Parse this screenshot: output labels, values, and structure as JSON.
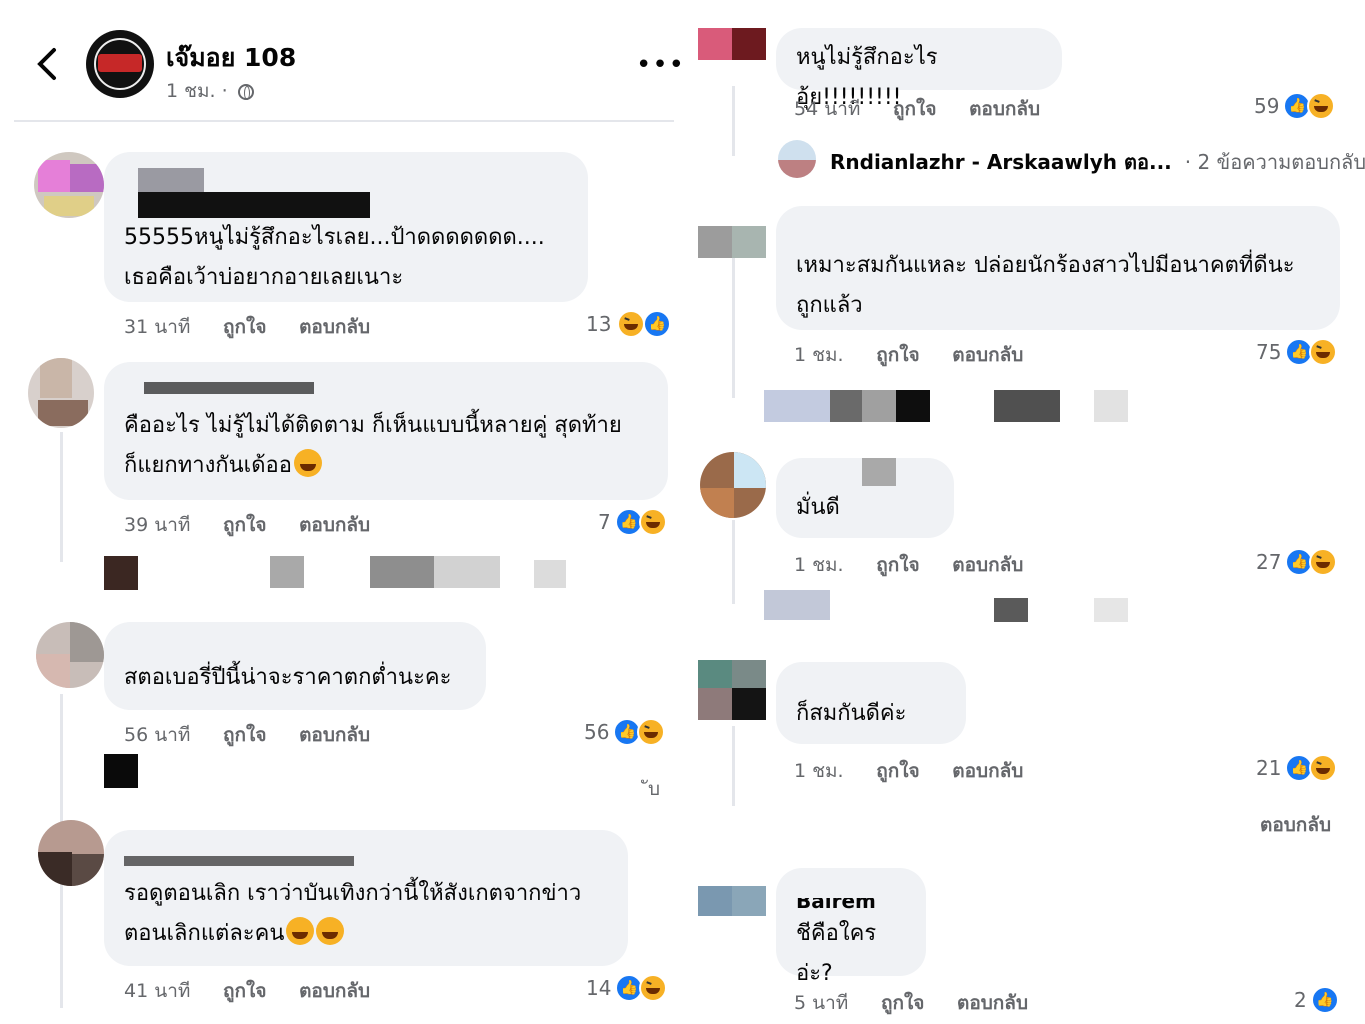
{
  "header": {
    "page_name": "เจ๊มอย 108",
    "time": "1 ชม. ·",
    "more": "•••"
  },
  "comments_left": [
    {
      "text": "55555หนูไม่รู้สึกอะไรเลย...ป้าดดดดดดด....\nเธอคือเว้าบ่อยากอายเลยเนาะ",
      "time": "31 นาที",
      "like": "ถูกใจ",
      "reply": "ตอบกลับ",
      "count": "13"
    },
    {
      "text": "คืออะไร ไม่รู้ไม่ได้ติดตาม ก็เห็นแบบนี้หลายคู่ สุดท้าย\nก็แยกทางกันเด้ออ",
      "time": "39 นาที",
      "like": "ถูกใจ",
      "reply": "ตอบกลับ",
      "count": "7"
    },
    {
      "text": "สตอเบอรี่ปีนี้น่าจะราคาตกต่ำนะคะ",
      "time": "56 นาที",
      "like": "ถูกใจ",
      "reply": "ตอบกลับ",
      "count": "56",
      "extra": "ับ"
    },
    {
      "text": "รอดูตอนเลิก เราว่าบันเทิงกว่านี้ให้สังเกตจากข่าว\nตอนเลิกแต่ละคน",
      "time": "41 นาที",
      "like": "ถูกใจ",
      "reply": "ตอบกลับ",
      "count": "14"
    }
  ],
  "comments_right": [
    {
      "text": "หนูไม่รู้สึกอะไร อุ้ย!!!!!!!!!",
      "time": "54 นาที",
      "like": "ถูกใจ",
      "reply": "ตอบกลับ",
      "count": "59"
    },
    {
      "text": "เหมาะสมกันแหละ ปล่อยนักร้องสาวไปมีอนาคตที่ดีนะ\nถูกแล้ว",
      "time": "1 ชม.",
      "like": "ถูกใจ",
      "reply": "ตอบกลับ",
      "count": "75"
    },
    {
      "text": "มั่นดี",
      "time": "1 ชม.",
      "like": "ถูกใจ",
      "reply": "ตอบกลับ",
      "count": "27"
    },
    {
      "text": "ก็สมกันดีค่ะ",
      "time": "1 ชม.",
      "like": "ถูกใจ",
      "reply": "ตอบกลับ",
      "count": "21",
      "extra": "ตอบกลับ"
    },
    {
      "text": "ชีคือใครอ่ะ?",
      "time": "5 นาที",
      "like": "ถูกใจ",
      "reply": "ตอบกลับ",
      "count": "2",
      "partial_name": "Bairem"
    }
  ],
  "reply_summary": {
    "name": "Rndianlazhr - Arskaawlyh ตอ...",
    "count_text": "· 2 ข้อความตอบกลับ"
  },
  "colors": {
    "bubble": "#f0f2f5",
    "meta": "#65676b",
    "like_blue": "#1877f2",
    "haha_yellow": "#f7b125"
  }
}
